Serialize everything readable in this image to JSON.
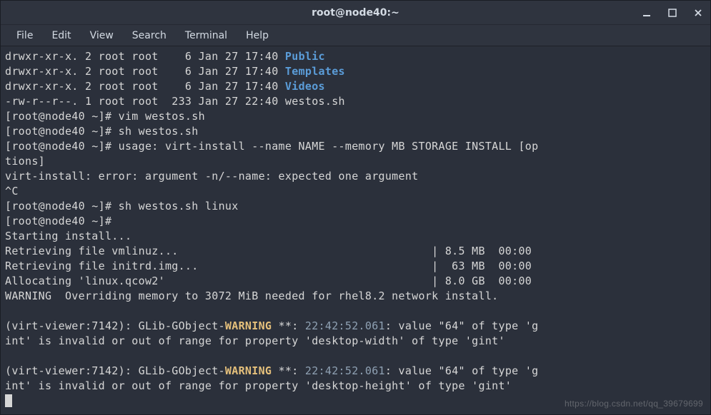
{
  "window": {
    "title": "root@node40:~"
  },
  "menubar": {
    "file": "File",
    "edit": "Edit",
    "view": "View",
    "search": "Search",
    "terminal": "Terminal",
    "help": "Help"
  },
  "ls": {
    "l1_perm": "drwxr-xr-x. 2 root root    6 Jan 27 17:40 ",
    "l1_name": "Public",
    "l2_perm": "drwxr-xr-x. 2 root root    6 Jan 27 17:40 ",
    "l2_name": "Templates",
    "l3_perm": "drwxr-xr-x. 2 root root    6 Jan 27 17:40 ",
    "l3_name": "Videos",
    "l4": "-rw-r--r--. 1 root root  233 Jan 27 22:40 westos.sh"
  },
  "cmds": {
    "p1": "[root@node40 ~]# vim westos.sh",
    "p2": "[root@node40 ~]# sh westos.sh",
    "usage": "[root@node40 ~]# usage: virt-install --name NAME --memory MB STORAGE INSTALL [op",
    "usage2": "tions]",
    "err": "virt-install: error: argument -n/--name: expected one argument",
    "ctrlc": "^C",
    "p3": "[root@node40 ~]# sh westos.sh linux",
    "p4": "[root@node40 ~]# ",
    "start": "Starting install...",
    "r1": "Retrieving file vmlinuz...                                      | 8.5 MB  00:00",
    "r2": "Retrieving file initrd.img...                                   |  63 MB  00:00",
    "r3": "Allocating 'linux.qcow2'                                        | 8.0 GB  00:00",
    "warn_override": "WARNING  Overriding memory to 3072 MiB needed for rhel8.2 network install."
  },
  "glib": {
    "prefix": "(virt-viewer:7142): GLib-GObject-",
    "level": "WARNING",
    "stars": " **: ",
    "ts": "22:42:52.061",
    "m1a": ": value \"64\" of type 'g",
    "m1b": "int' is invalid or out of range for property 'desktop-width' of type 'gint'",
    "m2a": ": value \"64\" of type 'g",
    "m2b": "int' is invalid or out of range for property 'desktop-height' of type 'gint'"
  },
  "watermark": "https://blog.csdn.net/qq_39679699"
}
